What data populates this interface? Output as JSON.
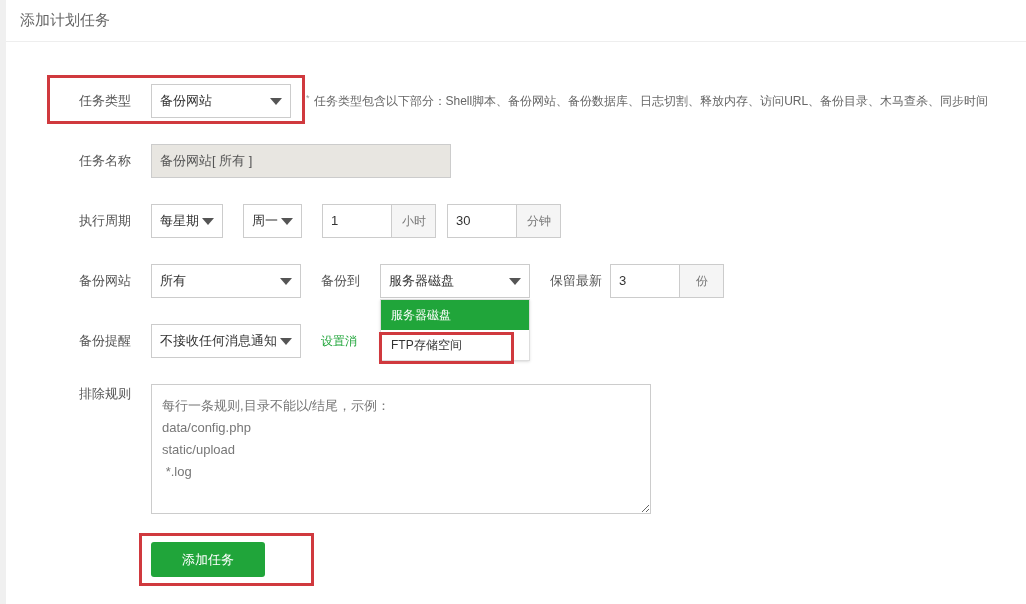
{
  "page": {
    "title": "添加计划任务"
  },
  "task_type": {
    "label": "任务类型",
    "value": "备份网站",
    "highlighted": true,
    "hint_mark": "*",
    "hint": "任务类型包含以下部分：Shell脚本、备份网站、备份数据库、日志切割、释放内存、访问URL、备份目录、木马查杀、同步时间"
  },
  "task_name": {
    "label": "任务名称",
    "value": "备份网站[ 所有 ]",
    "disabled": true
  },
  "schedule": {
    "label": "执行周期",
    "period": "每星期",
    "weekday": "周一",
    "hour": "1",
    "hour_unit": "小时",
    "minute": "30",
    "minute_unit": "分钟"
  },
  "backup_site": {
    "label": "备份网站",
    "value": "所有",
    "target_label": "备份到",
    "target_value": "服务器磁盘",
    "target_expanded": true,
    "target_options": [
      {
        "label": "服务器磁盘",
        "selected": true,
        "highlighted": false
      },
      {
        "label": "FTP存储空间",
        "selected": false,
        "highlighted": true
      }
    ],
    "keep_label": "保留最新",
    "keep_value": "3",
    "keep_unit": "份"
  },
  "notify": {
    "label": "备份提醒",
    "value": "不接收任何消息通知",
    "link": "设置消"
  },
  "exclude": {
    "label": "排除规则",
    "placeholder": "每行一条规则,目录不能以/结尾，示例：\ndata/config.php\nstatic/upload\n *.log"
  },
  "submit": {
    "label": "添加任务",
    "highlighted": true
  }
}
